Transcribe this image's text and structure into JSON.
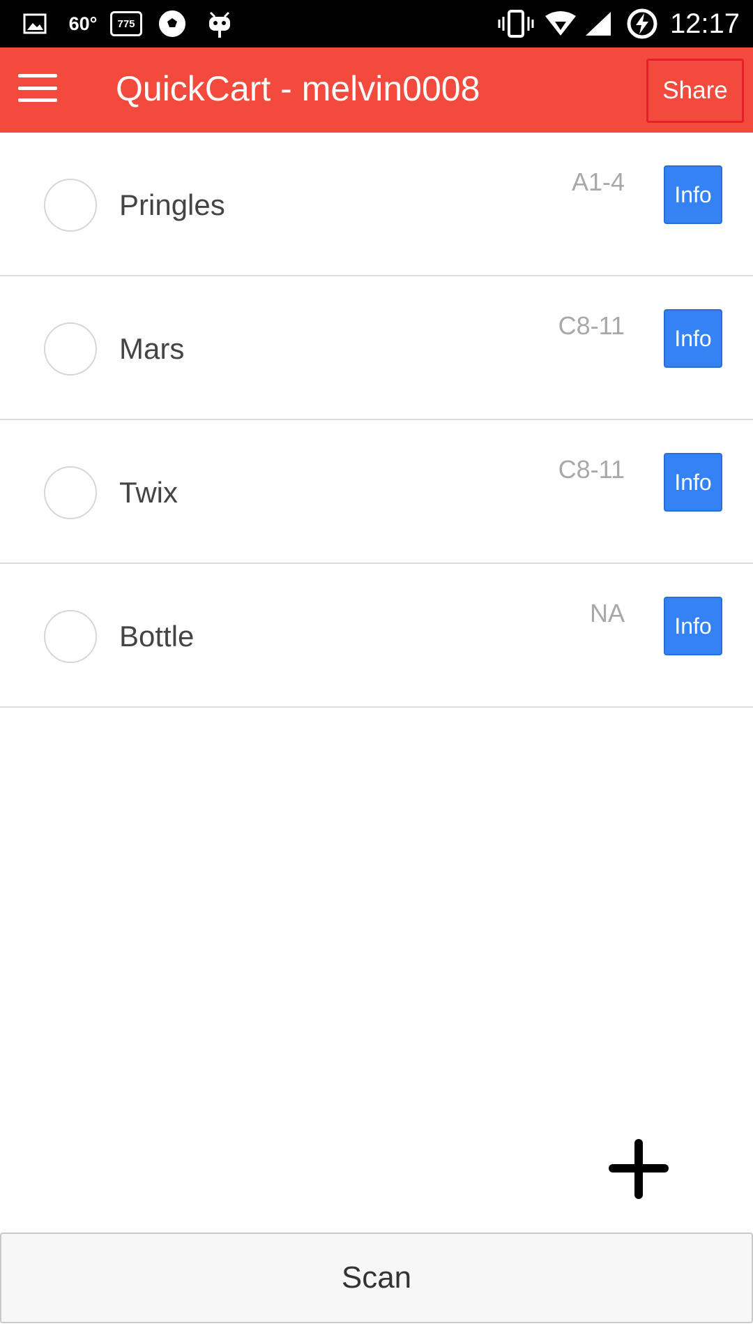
{
  "status_bar": {
    "temperature": "60°",
    "counter": "775",
    "time": "12:17",
    "icons": [
      "image-icon",
      "soccer-ball-icon",
      "android-icon",
      "vibrate-icon",
      "wifi-icon",
      "signal-icon",
      "battery-charging-icon"
    ]
  },
  "app_bar": {
    "title": "QuickCart - melvin0008",
    "share_label": "Share",
    "color": "#f24a3c"
  },
  "items": [
    {
      "name": "Pringles",
      "location": "A1-4",
      "info_label": "Info"
    },
    {
      "name": "Mars",
      "location": "C8-11",
      "info_label": "Info"
    },
    {
      "name": "Twix",
      "location": "C8-11",
      "info_label": "Info"
    },
    {
      "name": "Bottle",
      "location": "NA",
      "info_label": "Info"
    }
  ],
  "scan_label": "Scan",
  "colors": {
    "info_button": "#3582f4",
    "status_bar": "#000000"
  }
}
